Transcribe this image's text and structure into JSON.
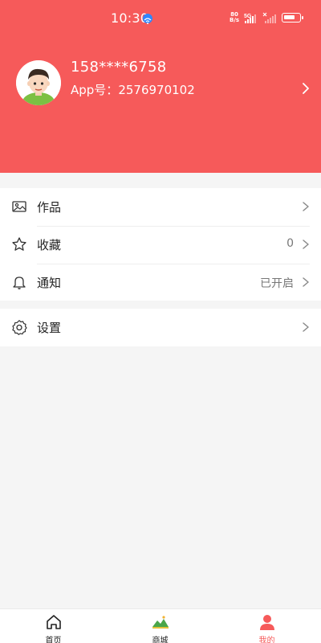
{
  "statusbar": {
    "time": "10:30",
    "net_speed_top": "80",
    "net_speed_bottom": "B/s",
    "network": "5G",
    "icons": [
      "wifi-badge-icon",
      "signal-icon",
      "battery-icon"
    ]
  },
  "profile": {
    "phone": "158****6758",
    "app_id_label": "App号：",
    "app_id": "2576970102"
  },
  "menu": {
    "items": [
      {
        "label": "作品",
        "value": "",
        "icon": "image-icon"
      },
      {
        "label": "收藏",
        "value": "0",
        "icon": "star-icon"
      },
      {
        "label": "通知",
        "value": "已开启",
        "icon": "bell-icon"
      }
    ],
    "settings": {
      "label": "设置",
      "icon": "gear-icon"
    }
  },
  "bottom_nav": {
    "items": [
      {
        "label": "首页",
        "icon": "home-icon"
      },
      {
        "label": "商城",
        "icon": "mall-icon"
      },
      {
        "label": "我的",
        "icon": "user-icon",
        "active": true
      }
    ]
  },
  "colors": {
    "accent": "#f65a5a",
    "background": "#f5f5f5"
  }
}
